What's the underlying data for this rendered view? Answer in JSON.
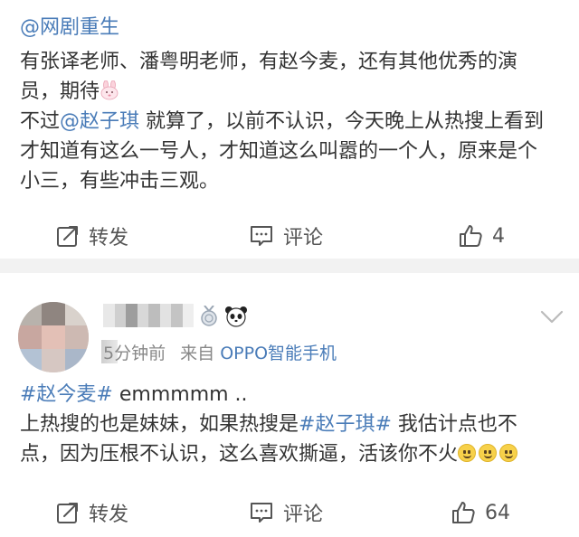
{
  "post1": {
    "top_mention": "@网剧重生",
    "line1": "有张译老师、潘粤明老师，有赵今麦，还有其他优秀的演",
    "line2": "员，期待",
    "emoji_name": "bunny-emoji",
    "line3_pre": "不过",
    "line3_mention": "@赵子琪",
    "line3_post": " 就算了，以前不认识，今天晚上从热搜上看到",
    "line4": "才知道有这么一号人，才知道这么叫嚣的一个人，原来是个",
    "line5": "小三，有些冲击三观。",
    "actions": {
      "repost": "转发",
      "comment": "评论",
      "like_count": "4"
    }
  },
  "post2": {
    "time": "5分钟前",
    "source_prefix": "来自",
    "source": "OPPO智能手机",
    "tag1": "#赵今麦#",
    "line1_post": " emmmmm ..",
    "line2_pre": "上热搜的也是妹妹，如果热搜是",
    "tag2": "#赵子琪#",
    "line2_post": " 我估计点也不",
    "line3": "点，因为压根不认识，这么喜欢撕逼，活该你不火",
    "emoji_name": "smile-emoji",
    "actions": {
      "repost": "转发",
      "comment": "评论",
      "like_count": "64"
    }
  },
  "icons": [
    "repost-icon",
    "comment-icon",
    "like-icon",
    "chevron-down-icon",
    "medal-icon",
    "panda-icon"
  ],
  "colors": {
    "link": "#4a7cb8",
    "text": "#333333",
    "meta": "#888888",
    "divider": "#f2f2f2"
  }
}
